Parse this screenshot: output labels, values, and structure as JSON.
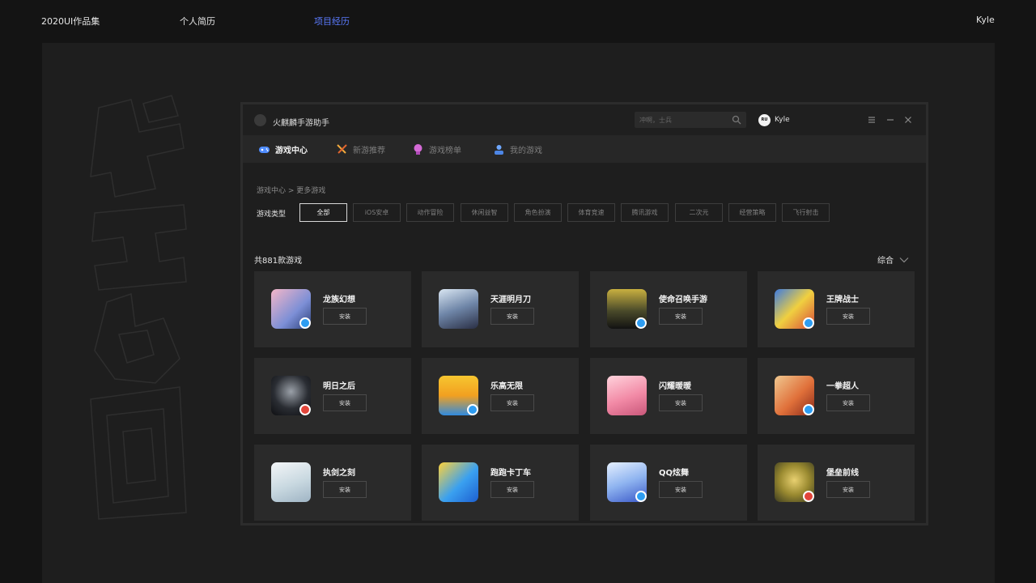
{
  "topnav": {
    "brand": "2020UI作品集",
    "resume": "个人简历",
    "projects": "项目经历",
    "user": "Kyle"
  },
  "app": {
    "title": "火麒麟手游助手",
    "search_placeholder": "冲啊，士兵",
    "user_avatar_text": "RU",
    "user_name": "Kyle"
  },
  "tabs": [
    {
      "label": "游戏中心",
      "icon": "gamepad-icon",
      "active": true
    },
    {
      "label": "新游推荐",
      "icon": "swords-icon",
      "active": false
    },
    {
      "label": "游戏榜单",
      "icon": "medal-icon",
      "active": false
    },
    {
      "label": "我的游戏",
      "icon": "user-icon",
      "active": false
    }
  ],
  "breadcrumb": "游戏中心 > 更多游戏",
  "filter": {
    "label": "游戏类型",
    "chips": [
      "全部",
      "iOS安卓",
      "动作冒险",
      "休闲益智",
      "角色扮演",
      "体育竞速",
      "腾讯游戏",
      "二次元",
      "经营策略",
      "飞行射击"
    ],
    "selected": "全部"
  },
  "count_text": "共881款游戏",
  "sort_label": "综合",
  "install_label": "安装",
  "games": [
    {
      "name": "龙族幻想"
    },
    {
      "name": "天涯明月刀"
    },
    {
      "name": "使命召唤手游"
    },
    {
      "name": "王牌战士"
    },
    {
      "name": "明日之后"
    },
    {
      "name": "乐高无限"
    },
    {
      "name": "闪耀暖暖"
    },
    {
      "name": "一拳超人"
    },
    {
      "name": "执剑之刻"
    },
    {
      "name": "跑跑卡丁车"
    },
    {
      "name": "QQ炫舞"
    },
    {
      "name": "堡垒前线"
    }
  ],
  "colors": {
    "accent": "#5b7bff",
    "card": "#2a2a2a",
    "window": "#1e1e1e",
    "tabbar": "#272727"
  }
}
